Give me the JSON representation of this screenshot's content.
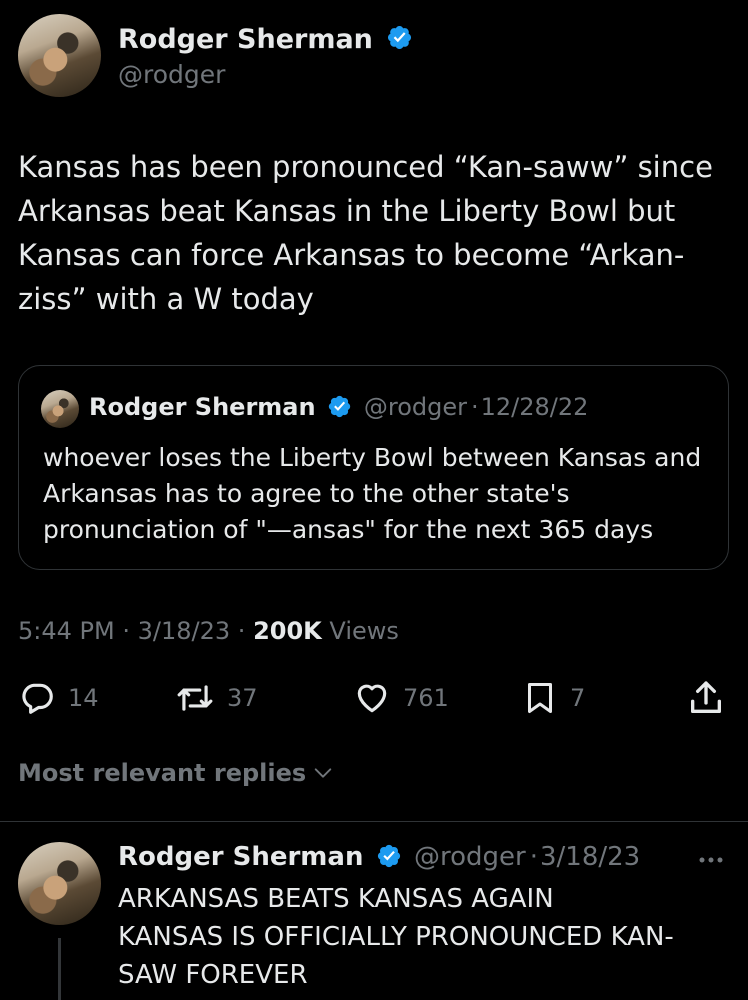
{
  "tweet": {
    "author_name": "Rodger Sherman",
    "author_handle": "@rodger",
    "text": "Kansas has been pronounced “Kan-saww” since Arkansas beat Kansas in the Liberty Bowl but Kansas can force Arkansas to become “Arkan-ziss” with a W today",
    "time": "5:44 PM",
    "date": "3/18/23",
    "views_count": "200K",
    "views_label": "Views"
  },
  "quote": {
    "author_name": "Rodger Sherman",
    "author_handle": "@rodger",
    "date": "12/28/22",
    "text": "whoever loses the Liberty Bowl between Kansas and Arkansas has to agree to the other state's pronunciation of \"—ansas\" for the next 365 days"
  },
  "actions": {
    "replies": "14",
    "retweets": "37",
    "likes": "761",
    "bookmarks": "7"
  },
  "replies_filter": {
    "label": "Most relevant replies"
  },
  "reply": {
    "author_name": "Rodger Sherman",
    "author_handle": "@rodger",
    "date": "3/18/23",
    "text": "ARKANSAS BEATS KANSAS AGAIN\nKANSAS IS OFFICIALLY PRONOUNCED KAN-SAW FOREVER"
  },
  "separator": "·",
  "colors": {
    "background": "#000000",
    "text": "#e7e9ea",
    "muted": "#71767b",
    "verified": "#1d9bf0",
    "border": "#2f3336"
  },
  "icons": [
    "verified-badge-icon",
    "reply-icon",
    "retweet-icon",
    "like-icon",
    "bookmark-icon",
    "share-icon",
    "chevron-down-icon",
    "more-icon"
  ]
}
